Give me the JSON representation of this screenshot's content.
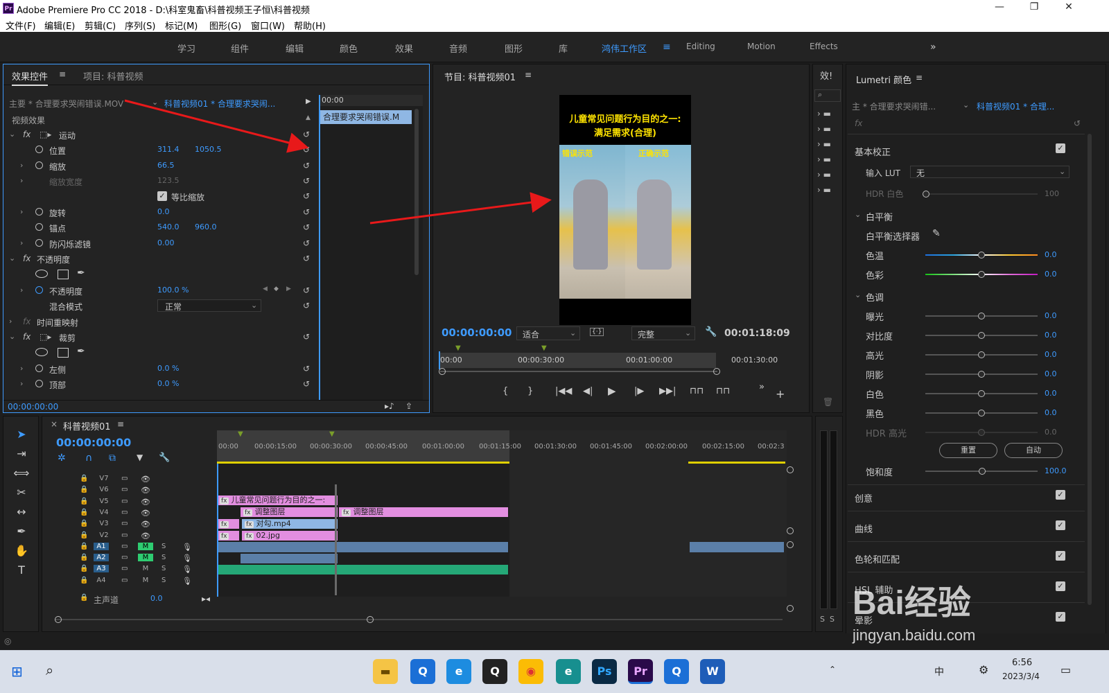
{
  "window": {
    "app_icon": "Pr",
    "title": "Adobe Premiere Pro CC 2018 - D:\\科室鬼畜\\科普视频王子恒\\科普视频",
    "minimize": "—",
    "maximize": "❐",
    "close": "✕"
  },
  "menu": [
    "文件(F)",
    "编辑(E)",
    "剪辑(C)",
    "序列(S)",
    "标记(M)",
    "图形(G)",
    "窗口(W)",
    "帮助(H)"
  ],
  "workspaces": [
    "学习",
    "组件",
    "编辑",
    "颜色",
    "效果",
    "音频",
    "图形",
    "库",
    "鸿伟工作区",
    "Editing",
    "Motion",
    "Effects"
  ],
  "workspace_active": "鸿伟工作区",
  "effect_controls": {
    "tab_active": "效果控件",
    "tab_other": "项目: 科普视频",
    "master_label": "主要 * 合理要求哭闹错误.MOV",
    "sequence_label": "科普视频01 * 合理要求哭闹...",
    "mini_time": "00:00",
    "mini_clip": "合理要求哭闹错误.M",
    "section": "视频效果",
    "motion": "运动",
    "position_label": "位置",
    "position_x": "311.4",
    "position_y": "1050.5",
    "scale_label": "缩放",
    "scale_value": "66.5",
    "scale_width_label": "缩放宽度",
    "scale_width_value": "123.5",
    "uniform_label": "等比缩放",
    "rotation_label": "旋转",
    "rotation_value": "0.0",
    "anchor_label": "锚点",
    "anchor_x": "540.0",
    "anchor_y": "960.0",
    "flicker_label": "防闪烁滤镜",
    "flicker_value": "0.00",
    "opacity_section": "不透明度",
    "opacity_label": "不透明度",
    "opacity_value": "100.0 %",
    "blend_label": "混合模式",
    "blend_value": "正常",
    "time_remap": "时间重映射",
    "crop": "裁剪",
    "left_label": "左侧",
    "left_value": "0.0 %",
    "top_label": "顶部",
    "top_value": "0.0 %",
    "timecode": "00:00:00:00"
  },
  "program": {
    "title": "节目: 科普视频01",
    "video_title_line1": "儿童常见问题行为目的之一:",
    "video_title_line2": "满足需求(合理)",
    "wrong_label": "错误示范",
    "right_label": "正确示范",
    "timecode": "00:00:00:00",
    "fit": "适合",
    "quality": "完整",
    "duration": "00:01:18:09",
    "ruler": [
      "00:00",
      "00:00:30:00",
      "00:01:00:00",
      "00:01:30:00"
    ]
  },
  "effects_panel": {
    "title": "效!"
  },
  "lumetri": {
    "title": "Lumetri 颜色",
    "master": "主 * 合理要求哭闹错...",
    "sequence": "科普视频01 * 合理...",
    "fx": "fx",
    "basic": "基本校正",
    "lut_label": "输入 LUT",
    "lut_value": "无",
    "hdr_white_label": "HDR 白色",
    "hdr_white_value": "100",
    "wb": "白平衡",
    "wb_picker": "白平衡选择器",
    "sliders": [
      {
        "label": "色温",
        "value": "0.0",
        "pos": 0.5
      },
      {
        "label": "色彩",
        "value": "0.0",
        "pos": 0.5
      }
    ],
    "tone": "色调",
    "tone_sliders": [
      {
        "label": "曝光",
        "value": "0.0",
        "pos": 0.5
      },
      {
        "label": "对比度",
        "value": "0.0",
        "pos": 0.5
      },
      {
        "label": "高光",
        "value": "0.0",
        "pos": 0.5
      },
      {
        "label": "阴影",
        "value": "0.0",
        "pos": 0.5
      },
      {
        "label": "白色",
        "value": "0.0",
        "pos": 0.5
      },
      {
        "label": "黑色",
        "value": "0.0",
        "pos": 0.5
      },
      {
        "label": "HDR 高光",
        "value": "0.0",
        "pos": 0.5
      }
    ],
    "reset": "重置",
    "auto": "自动",
    "saturation_label": "饱和度",
    "saturation_value": "100.0",
    "sections": [
      "创意",
      "曲线",
      "色轮和匹配",
      "HSL 辅助",
      "晕影"
    ]
  },
  "timeline": {
    "title": "科普视频01",
    "timecode": "00:00:00:00",
    "ruler": [
      "00:00",
      "00:00:15:00",
      "00:00:30:00",
      "00:00:45:00",
      "00:01:00:00",
      "00:01:15:00",
      "00:01:30:00",
      "00:01:45:00",
      "00:02:00:00",
      "00:02:15:00",
      "00:02:3"
    ],
    "video_tracks": [
      "V7",
      "V6",
      "V5",
      "V4",
      "V3",
      "V2"
    ],
    "audio_tracks": [
      "A1",
      "A2",
      "A3",
      "A4"
    ],
    "master_label": "主声道",
    "master_value": "0.0",
    "clip_v5": "儿童常见问题行为目的之一:",
    "clip_v4a": "调整图层",
    "clip_v4b": "调整图层",
    "clip_v3": "对勾.mp4",
    "clip_v2": "02.jpg"
  },
  "taskbar": {
    "time": "6:56",
    "date": "2023/3/4",
    "ime": "中"
  },
  "watermark": {
    "text": "Bai经验",
    "sub": "jingyan.baidu.com"
  }
}
